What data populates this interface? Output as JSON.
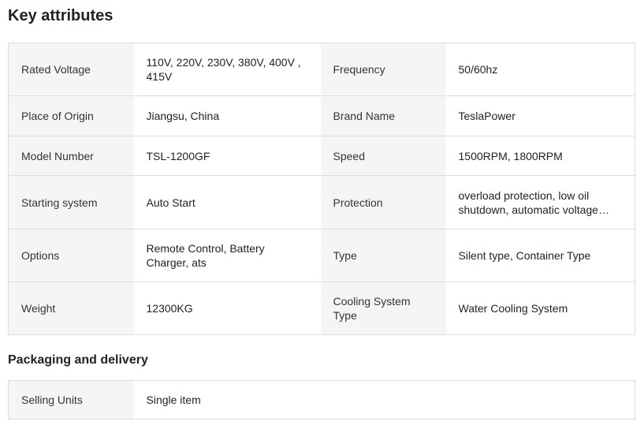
{
  "key_attributes": {
    "title": "Key attributes",
    "rows": [
      {
        "label1": "Rated Voltage",
        "value1": "110V, 220V, 230V, 380V, 400V , 415V",
        "label2": "Frequency",
        "value2": "50/60hz"
      },
      {
        "label1": "Place of Origin",
        "value1": "Jiangsu, China",
        "label2": "Brand Name",
        "value2": "TeslaPower"
      },
      {
        "label1": "Model Number",
        "value1": "TSL-1200GF",
        "label2": "Speed",
        "value2": "1500RPM, 1800RPM"
      },
      {
        "label1": "Starting system",
        "value1": "Auto Start",
        "label2": "Protection",
        "value2": "overload protection, low oil shutdown, automatic voltage regulation"
      },
      {
        "label1": "Options",
        "value1": "Remote Control, Battery Charger, ats",
        "label2": "Type",
        "value2": "Silent type, Container Type"
      },
      {
        "label1": "Weight",
        "value1": "12300KG",
        "label2": "Cooling System Type",
        "value2": "Water Cooling System"
      }
    ]
  },
  "packaging": {
    "title": "Packaging and delivery",
    "rows": [
      {
        "label": "Selling Units",
        "value": "Single item"
      }
    ]
  }
}
